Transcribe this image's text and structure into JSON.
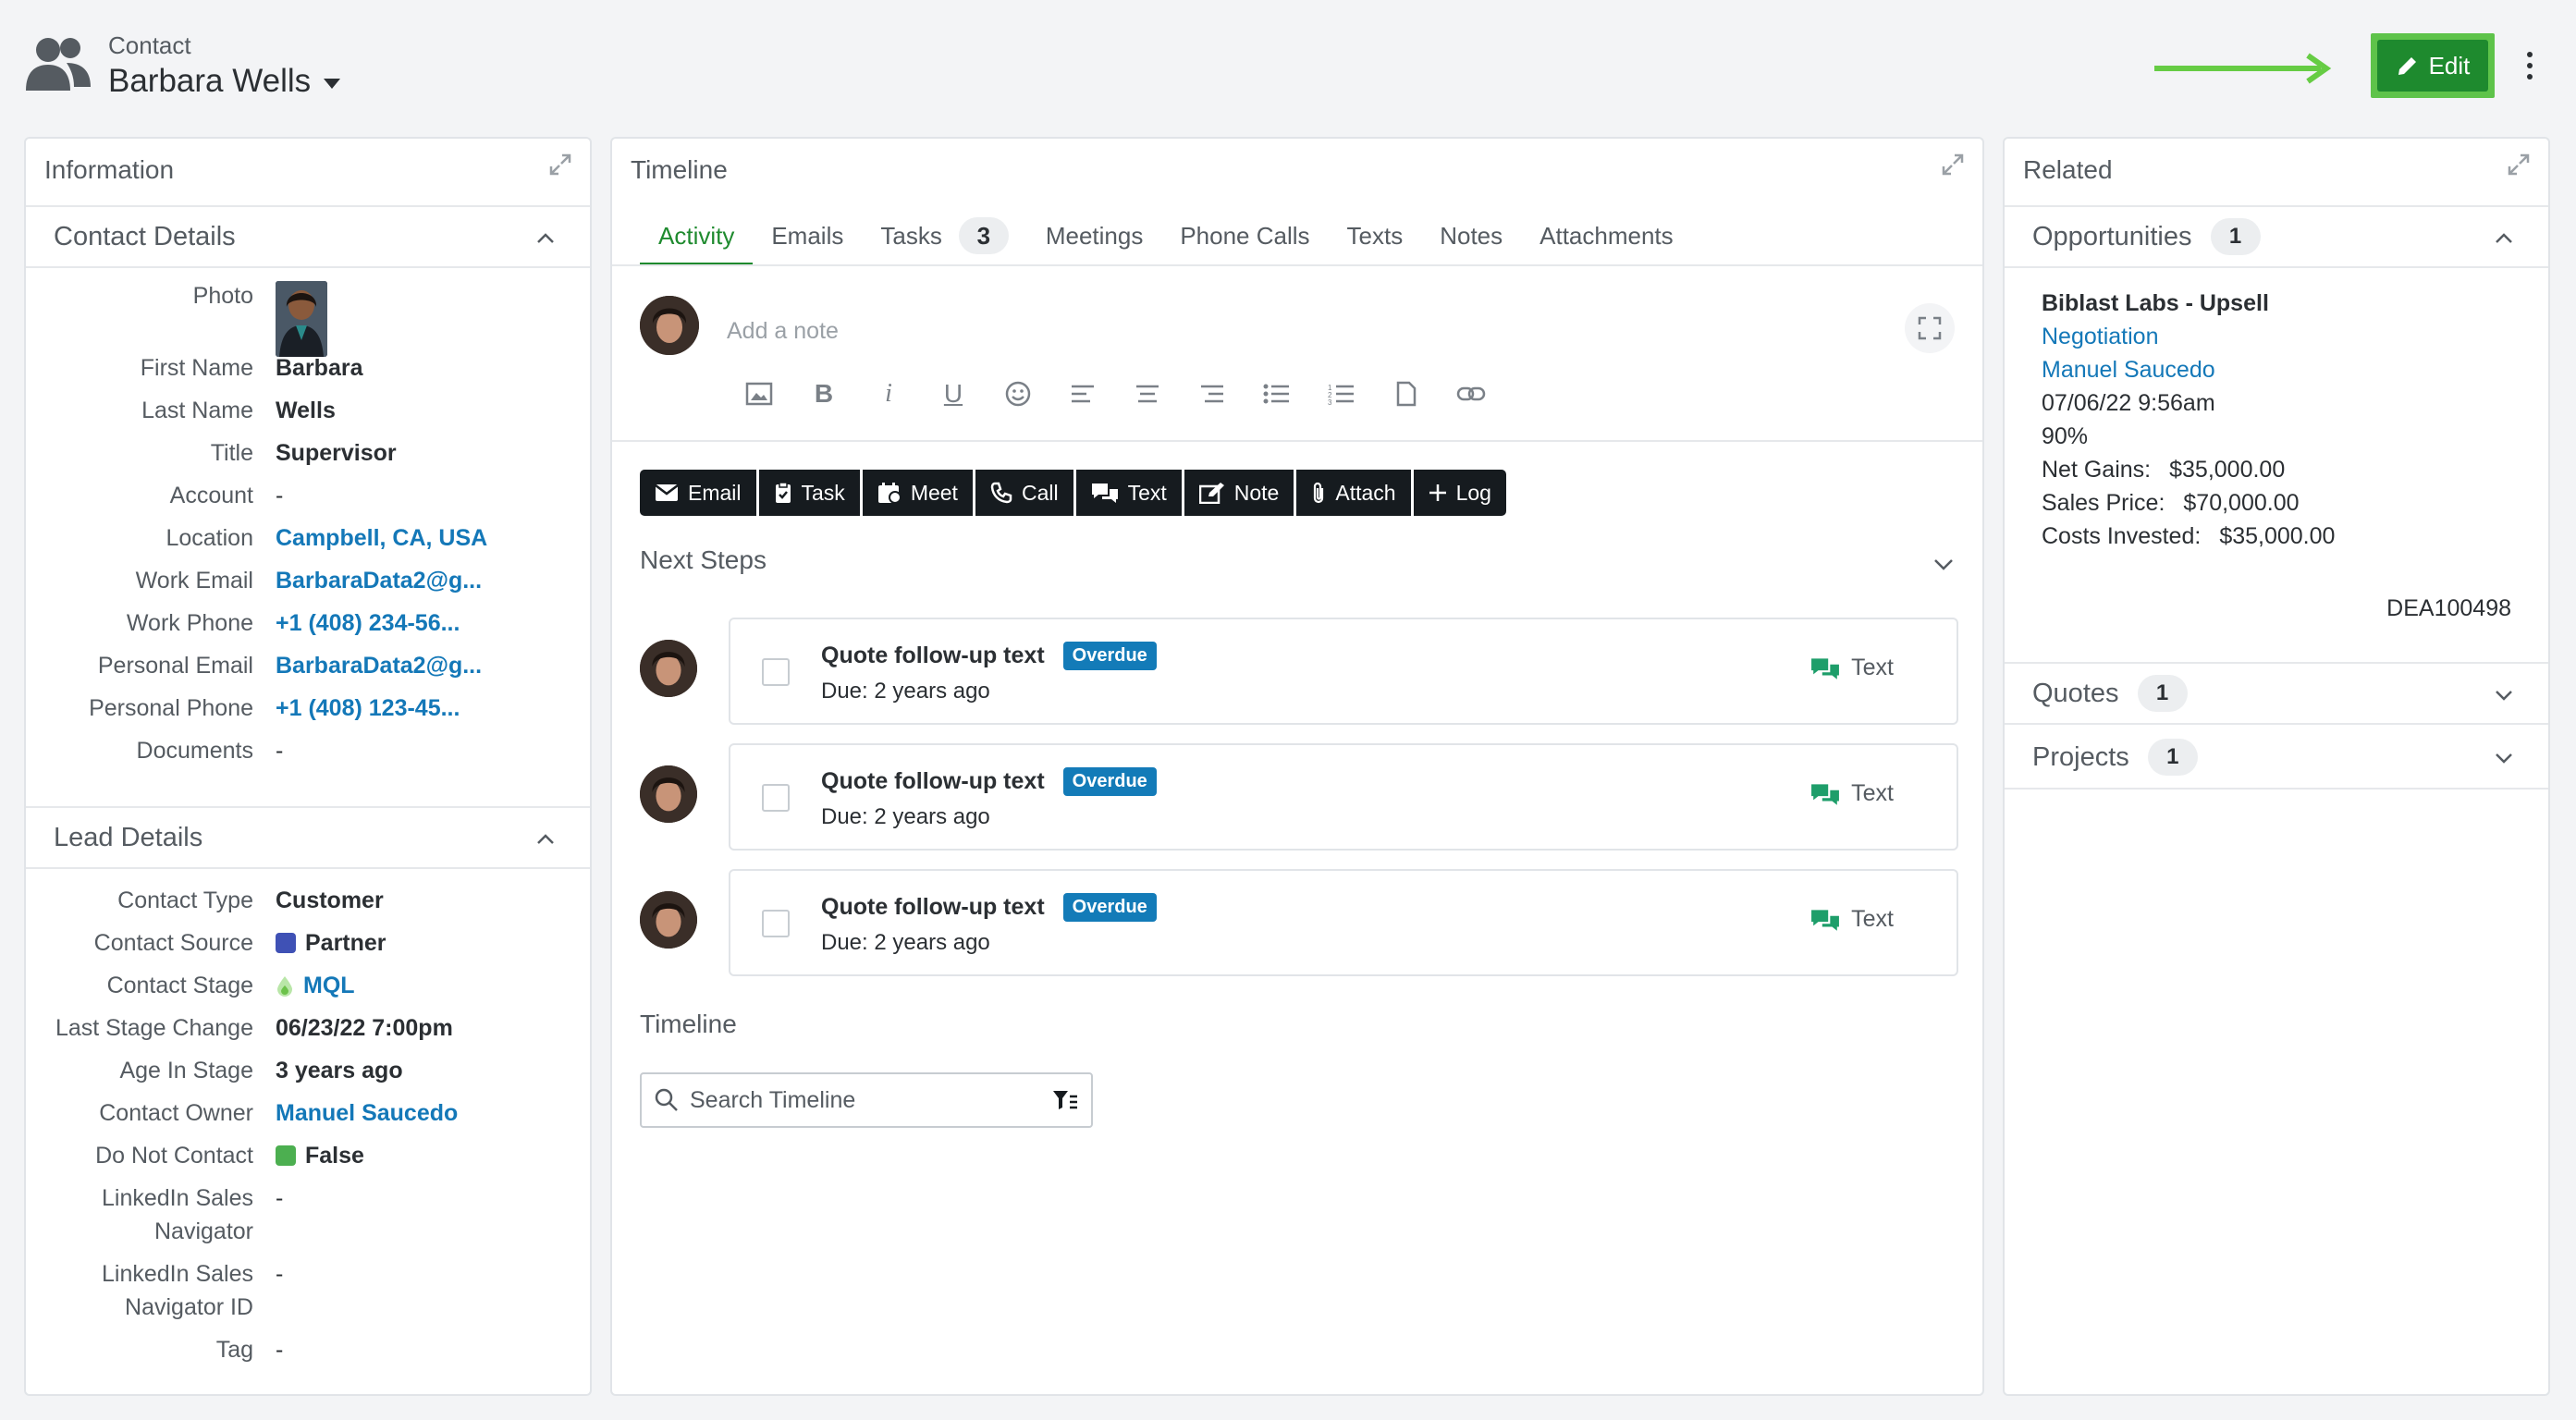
{
  "header": {
    "record_type": "Contact",
    "name": "Barbara Wells",
    "edit_label": "Edit"
  },
  "info": {
    "title": "Information",
    "contact_details": {
      "heading": "Contact Details",
      "photo_label": "Photo",
      "first_name_label": "First Name",
      "first_name": "Barbara",
      "last_name_label": "Last Name",
      "last_name": "Wells",
      "title_label": "Title",
      "title": "Supervisor",
      "account_label": "Account",
      "account": "-",
      "location_label": "Location",
      "location": "Campbell, CA, USA",
      "work_email_label": "Work Email",
      "work_email": "BarbaraData2@g...",
      "work_phone_label": "Work Phone",
      "work_phone": "+1 (408) 234-56...",
      "personal_email_label": "Personal Email",
      "personal_email": "BarbaraData2@g...",
      "personal_phone_label": "Personal Phone",
      "personal_phone": "+1 (408) 123-45...",
      "documents_label": "Documents",
      "documents": "-"
    },
    "lead_details": {
      "heading": "Lead Details",
      "contact_type_label": "Contact Type",
      "contact_type": "Customer",
      "contact_source_label": "Contact Source",
      "contact_source": "Partner",
      "contact_source_color": "#3f51b5",
      "contact_stage_label": "Contact Stage",
      "contact_stage": "MQL",
      "last_stage_change_label": "Last Stage Change",
      "last_stage_change": "06/23/22 7:00pm",
      "age_in_stage_label": "Age In Stage",
      "age_in_stage": "3 years ago",
      "contact_owner_label": "Contact Owner",
      "contact_owner": "Manuel Saucedo",
      "do_not_contact_label": "Do Not Contact",
      "do_not_contact": "False",
      "do_not_contact_color": "#4caf50",
      "linkedin_nav_label_1": "LinkedIn Sales",
      "linkedin_nav_label_2": "Navigator",
      "linkedin_nav": "-",
      "linkedin_nav_id_label_1": "LinkedIn Sales",
      "linkedin_nav_id_label_2": "Navigator ID",
      "linkedin_nav_id": "-",
      "tag_label": "Tag",
      "tag": "-"
    }
  },
  "timeline": {
    "title": "Timeline",
    "tabs": [
      {
        "label": "Activity"
      },
      {
        "label": "Emails"
      },
      {
        "label": "Tasks",
        "badge": "3"
      },
      {
        "label": "Meetings"
      },
      {
        "label": "Phone Calls"
      },
      {
        "label": "Texts"
      },
      {
        "label": "Notes"
      },
      {
        "label": "Attachments"
      }
    ],
    "note_placeholder": "Add a note",
    "actions": [
      "Email",
      "Task",
      "Meet",
      "Call",
      "Text",
      "Note",
      "Attach",
      "Log"
    ],
    "next_steps_heading": "Next Steps",
    "steps": [
      {
        "title": "Quote follow-up text",
        "status": "Overdue",
        "due": "Due: 2 years ago",
        "action": "Text"
      },
      {
        "title": "Quote follow-up text",
        "status": "Overdue",
        "due": "Due: 2 years ago",
        "action": "Text"
      },
      {
        "title": "Quote follow-up text",
        "status": "Overdue",
        "due": "Due: 2 years ago",
        "action": "Text"
      }
    ],
    "timeline_heading": "Timeline",
    "search_placeholder": "Search Timeline"
  },
  "related": {
    "title": "Related",
    "opportunities": {
      "label": "Opportunities",
      "count": "1",
      "name": "Biblast Labs - Upsell",
      "stage": "Negotiation",
      "owner": "Manuel Saucedo",
      "date": "07/06/22 9:56am",
      "probability": "90%",
      "net_gains_label": "Net Gains:",
      "net_gains": "$35,000.00",
      "sales_price_label": "Sales Price:",
      "sales_price": "$70,000.00",
      "costs_label": "Costs Invested:",
      "costs": "$35,000.00",
      "id": "DEA100498"
    },
    "quotes": {
      "label": "Quotes",
      "count": "1"
    },
    "projects": {
      "label": "Projects",
      "count": "1"
    }
  }
}
